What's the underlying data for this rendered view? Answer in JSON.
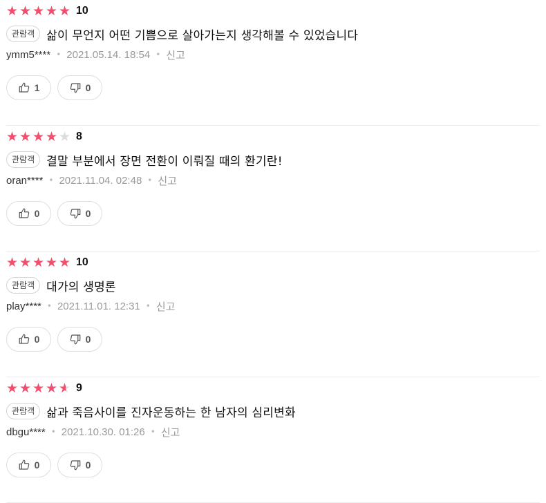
{
  "colors": {
    "star_on": "#f0506e",
    "star_off": "#dcdcdc"
  },
  "reviews": [
    {
      "rating_fraction": 1.0,
      "score": "10",
      "badge": "관람객",
      "comment": "삶이 무언지 어떤 기쁨으로 살아가는지 생각해볼 수 있었습니다",
      "author": "ymm5****",
      "date": "2021.05.14. 18:54",
      "report": "신고",
      "likes": "1",
      "dislikes": "0"
    },
    {
      "rating_fraction": 0.8,
      "score": "8",
      "badge": "관람객",
      "comment": "결말 부분에서 장면 전환이 이뤄질 때의 환기란!",
      "author": "oran****",
      "date": "2021.11.04. 02:48",
      "report": "신고",
      "likes": "0",
      "dislikes": "0"
    },
    {
      "rating_fraction": 1.0,
      "score": "10",
      "badge": "관람객",
      "comment": "대가의 생명론",
      "author": "play****",
      "date": "2021.11.01. 12:31",
      "report": "신고",
      "likes": "0",
      "dislikes": "0"
    },
    {
      "rating_fraction": 0.9,
      "score": "9",
      "badge": "관람객",
      "comment": "삶과 죽음사이를 진자운동하는 한 남자의 심리변화",
      "author": "dbgu****",
      "date": "2021.10.30. 01:26",
      "report": "신고",
      "likes": "0",
      "dislikes": "0"
    }
  ]
}
